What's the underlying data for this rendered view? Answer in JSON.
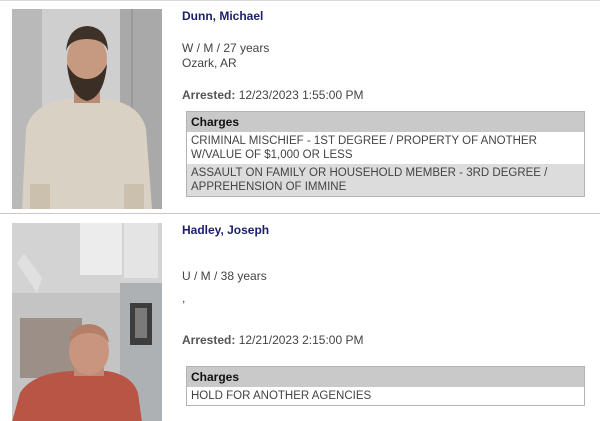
{
  "records": [
    {
      "name": "Dunn, Michael",
      "demographics": "W / M / 27 years",
      "location": "Ozark, AR",
      "arrested_label": "Arrested:",
      "arrested_value": "12/23/2023 1:55:00 PM",
      "charges_header": "Charges",
      "charges": [
        "CRIMINAL MISCHIEF - 1ST DEGREE / PROPERTY OF ANOTHER W/VALUE OF $1,000 OR LESS",
        "ASSAULT ON FAMILY OR HOUSEHOLD MEMBER - 3RD DEGREE / APPREHENSION OF IMMINE"
      ]
    },
    {
      "name": "Hadley, Joseph",
      "demographics": "U / M / 38 years",
      "location": ",",
      "arrested_label": "Arrested:",
      "arrested_value": "12/21/2023 2:15:00 PM",
      "charges_header": "Charges",
      "charges": [
        "HOLD FOR ANOTHER AGENCIES"
      ]
    }
  ],
  "colors": {
    "name": "#1b1e6b",
    "charges_header_bg": "#c9c9c9",
    "charges_alt_row_bg": "#dcdcdc"
  }
}
